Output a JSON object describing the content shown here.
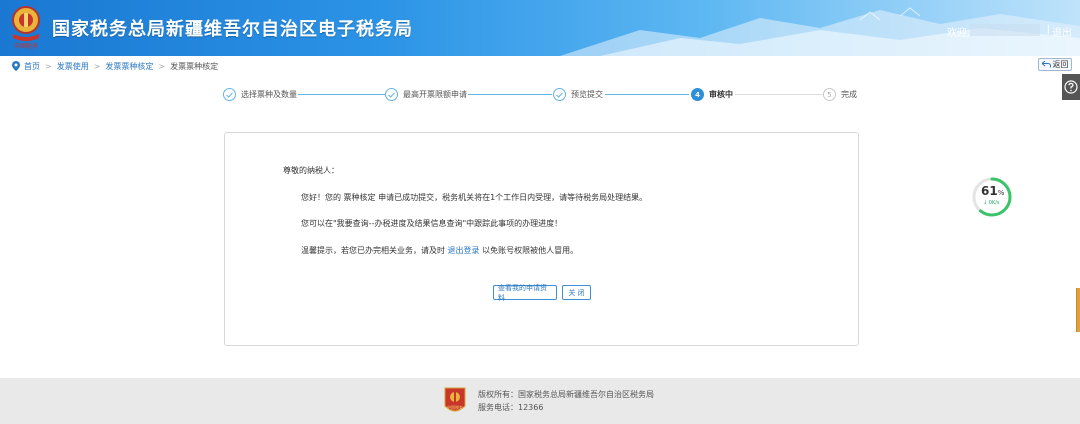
{
  "header": {
    "title": "国家税务总局新疆维吾尔自治区电子税务局",
    "welcome": "欢迎,",
    "separator": "|",
    "logout": "退出",
    "emblem_text": "中国税务"
  },
  "breadcrumb": {
    "items": [
      "首页",
      "发票使用",
      "发票票种核定",
      "发票票种核定"
    ],
    "back_label": "返回"
  },
  "steps": [
    {
      "label": "选择票种及数量",
      "state": "done"
    },
    {
      "label": "最高开票限额申请",
      "state": "done"
    },
    {
      "label": "预览提交",
      "state": "done"
    },
    {
      "label": "审核中",
      "state": "active",
      "number": "4"
    },
    {
      "label": "完成",
      "state": "pending",
      "number": "5"
    }
  ],
  "message": {
    "greeting": "尊敬的纳税人：",
    "p1": "您好！您的 票种核定 申请已成功提交，税务机关将在1个工作日内受理，请等待税务局处理结果。",
    "p2": "您可以在\"我要查询--办税进度及结果信息查询\"中跟踪此事项的办理进度！",
    "p3_before": "温馨提示，若您已办完相关业务，请及时 ",
    "p3_link": "退出登录",
    "p3_after": " 以免账号权限被他人冒用。"
  },
  "buttons": {
    "view_application": "查看我的申请资料",
    "close": "关 闭"
  },
  "widget": {
    "value": "61",
    "unit": "%",
    "speed": "↓ 0K/s",
    "progress": 0.61
  },
  "footer": {
    "copyright": "版权所有：国家税务总局新疆维吾尔自治区税务局",
    "phone": "服务电话：12366",
    "logo_text": "中国税务"
  },
  "colors": {
    "accent": "#2f8fdc",
    "link": "#2a78c2",
    "header_start": "#1a78d2",
    "progress_ring": "#39c46a"
  }
}
